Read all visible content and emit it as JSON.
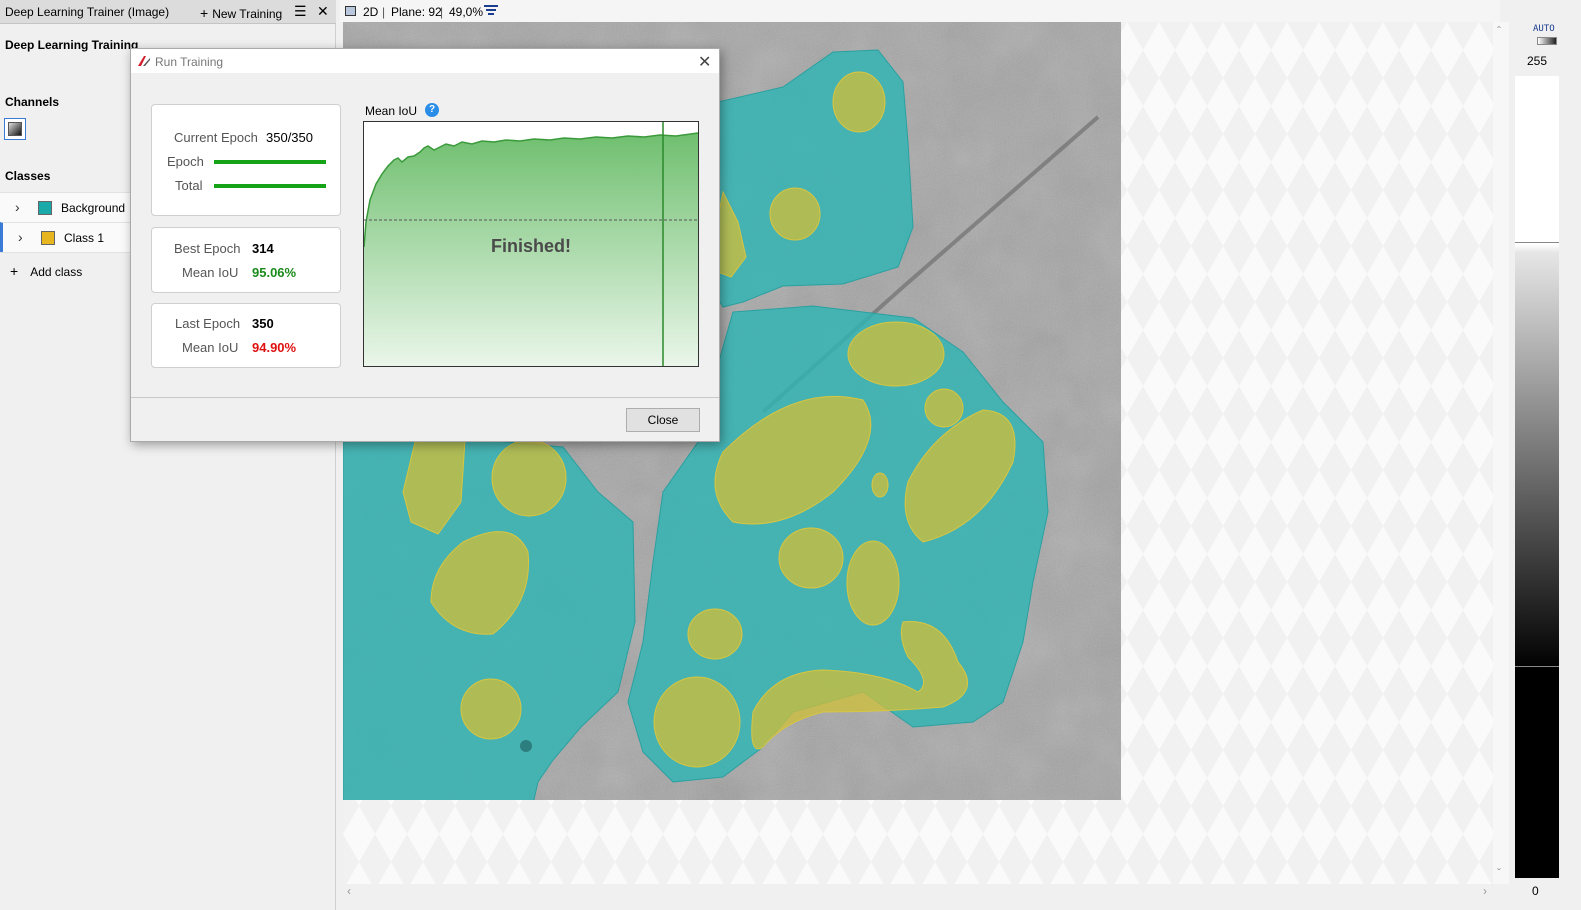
{
  "left_panel": {
    "tab_title": "Deep Learning Trainer (Image)",
    "new_training_label": "New Training",
    "panel_title": "Deep Learning Training",
    "channels_label": "Channels",
    "classes_label": "Classes",
    "classes": [
      {
        "label": "Background",
        "color": "#1aa9a9"
      },
      {
        "label": "Class 1",
        "color": "#e6b520"
      }
    ],
    "add_class_label": "Add class"
  },
  "viewer": {
    "mode": "2D",
    "plane": "Plane: 92",
    "zoom": "49,0%",
    "separator": "|",
    "overlay_colors": {
      "background": "#3bb3b3",
      "class1": "#c6c24a"
    }
  },
  "intensity": {
    "auto_label": "AUTO",
    "max": "255",
    "min": "0"
  },
  "dialog": {
    "title": "Run Training",
    "current_epoch_label": "Current Epoch",
    "current_epoch_value": "350/350",
    "epoch_progress_label": "Epoch",
    "total_progress_label": "Total",
    "epoch_progress": 1.0,
    "total_progress": 1.0,
    "best_epoch_label": "Best Epoch",
    "best_epoch_value": "314",
    "best_mean_iou_label": "Mean IoU",
    "best_mean_iou_value": "95.06%",
    "last_epoch_label": "Last Epoch",
    "last_epoch_value": "350",
    "last_mean_iou_label": "Mean IoU",
    "last_mean_iou_value": "94.90%",
    "chart_title": "Mean IoU",
    "help_glyph": "?",
    "finished_text": "Finished!",
    "close_label": "Close",
    "best_color": "#1a8a1a",
    "last_color": "#e01010"
  }
}
